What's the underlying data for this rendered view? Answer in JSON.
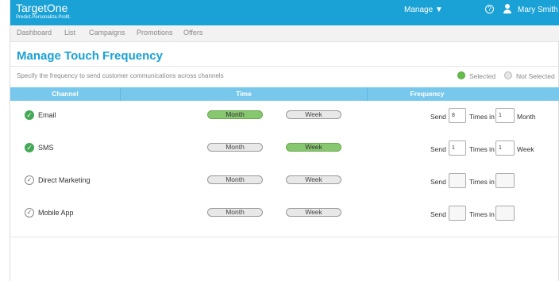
{
  "header": {
    "brand": "TargetOne",
    "tagline": "Predict.Personalize.Profit.",
    "manage_label": "Manage ▼",
    "help_icon": "?",
    "user_label": "Mary Smith ▼"
  },
  "nav": [
    "Dashboard",
    "List",
    "Campaigns",
    "Promotions",
    "Offers"
  ],
  "page": {
    "title": "Manage Touch Frequency",
    "subtitle": "Specify the frequency to send customer communications across channels",
    "legend_selected": "Selected",
    "legend_not_selected": "Not Selected"
  },
  "table": {
    "headers": [
      "Channel",
      "Time",
      "Frequency"
    ],
    "rows": [
      {
        "channel": "Email",
        "selected": true,
        "month_label": "Month",
        "week_label": "Week",
        "active": "month",
        "send_label": "Send",
        "send_value": "8",
        "times_label": "Times in",
        "times_value": "1",
        "unit": "Month"
      },
      {
        "channel": "SMS",
        "selected": true,
        "month_label": "Month",
        "week_label": "Week",
        "active": "week",
        "send_label": "Send",
        "send_value": "1",
        "times_label": "Times in",
        "times_value": "1",
        "unit": "Week"
      },
      {
        "channel": "Direct Marketing",
        "selected": false,
        "month_label": "Month",
        "week_label": "Week",
        "active": "",
        "send_label": "Send",
        "send_value": "",
        "times_label": "Times in",
        "times_value": "",
        "unit": ""
      },
      {
        "channel": "Mobile App",
        "selected": false,
        "month_label": "Month",
        "week_label": "Week",
        "active": "",
        "send_label": "Send",
        "send_value": "",
        "times_label": "Times in",
        "times_value": "",
        "unit": ""
      }
    ]
  },
  "colors": {
    "brand_blue": "#1aa1d6",
    "header_blue": "#78c8ed",
    "selected_green": "#86c76f",
    "check_green": "#44a857"
  }
}
